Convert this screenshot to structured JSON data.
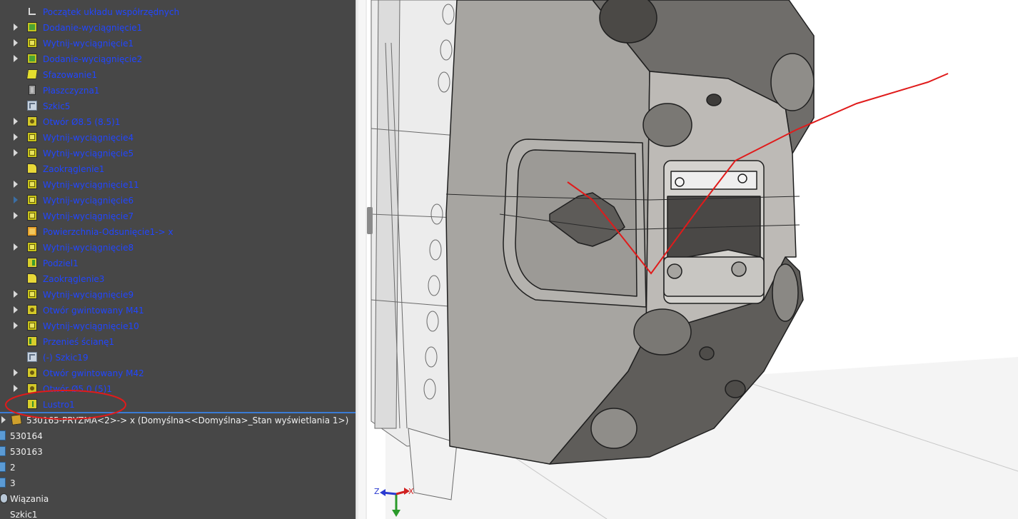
{
  "feature_tree": {
    "items": [
      {
        "label": "Początek układu współrzędnych",
        "icon": "coordinate-system-icon",
        "expand": false
      },
      {
        "label": "Dodanie-wyciągnięcie1",
        "icon": "extrude-icon",
        "expand": true
      },
      {
        "label": "Wytnij-wyciągnięcie1",
        "icon": "cut-extrude-icon",
        "expand": true
      },
      {
        "label": "Dodanie-wyciągnięcie2",
        "icon": "extrude-icon",
        "expand": true
      },
      {
        "label": "Sfazowanie1",
        "icon": "chamfer-icon",
        "expand": false
      },
      {
        "label": "Płaszczyzna1",
        "icon": "plane-icon",
        "expand": false
      },
      {
        "label": "Szkic5",
        "icon": "sketch-icon",
        "expand": false
      },
      {
        "label": "Otwór Ø8.5 (8.5)1",
        "icon": "hole-wizard-icon",
        "expand": true
      },
      {
        "label": "Wytnij-wyciągnięcie4",
        "icon": "cut-extrude-icon",
        "expand": true
      },
      {
        "label": "Wytnij-wyciągnięcie5",
        "icon": "cut-extrude-icon",
        "expand": true
      },
      {
        "label": "Zaokrąglenie1",
        "icon": "fillet-icon",
        "expand": false
      },
      {
        "label": "Wytnij-wyciągnięcie11",
        "icon": "cut-extrude-icon",
        "expand": true
      },
      {
        "label": "Wytnij-wyciągnięcie6",
        "icon": "cut-extrude-icon",
        "expand": "dim"
      },
      {
        "label": "Wytnij-wyciągnięcie7",
        "icon": "cut-extrude-icon",
        "expand": true
      },
      {
        "label": "Powierzchnia-Odsunięcie1-> x",
        "icon": "offset-surface-icon",
        "expand": false
      },
      {
        "label": "Wytnij-wyciągnięcie8",
        "icon": "cut-extrude-icon",
        "expand": true
      },
      {
        "label": "Podziel1",
        "icon": "split-icon",
        "expand": false
      },
      {
        "label": "Zaokrąglenie3",
        "icon": "fillet-icon",
        "expand": false
      },
      {
        "label": "Wytnij-wyciągnięcie9",
        "icon": "cut-extrude-icon",
        "expand": true
      },
      {
        "label": "Otwór gwintowany M41",
        "icon": "hole-wizard-icon",
        "expand": true
      },
      {
        "label": "Wytnij-wyciągnięcie10",
        "icon": "cut-extrude-icon",
        "expand": true
      },
      {
        "label": "Przenieś ścianę1",
        "icon": "move-face-icon",
        "expand": false
      },
      {
        "label": "(-) Szkic19",
        "icon": "sketch-icon",
        "expand": false
      },
      {
        "label": "Otwór gwintowany M42",
        "icon": "hole-wizard-icon",
        "expand": true
      },
      {
        "label": "Otwór Ø5.0 (5)1",
        "icon": "hole-wizard-icon",
        "expand": true
      },
      {
        "label": "Lustro1",
        "icon": "mirror-icon",
        "expand": false
      }
    ],
    "assembly": [
      {
        "label": "530165-PRYZMA<2>-> x (Domyślna<<Domyślna>_Stan wyświetlania 1>)",
        "icon": "part-icon"
      },
      {
        "label": "530164",
        "icon": "component-icon"
      },
      {
        "label": "530163",
        "icon": "component-icon"
      },
      {
        "label": "2",
        "icon": "component-icon"
      },
      {
        "label": "3",
        "icon": "component-icon"
      },
      {
        "label": "Wiązania",
        "icon": "mates-icon"
      },
      {
        "label": "Szkic1",
        "icon": "sketch-icon"
      }
    ]
  },
  "viewport": {
    "triad": {
      "x": "X",
      "z": "Z"
    },
    "annotation_color": "#e01b1b"
  }
}
